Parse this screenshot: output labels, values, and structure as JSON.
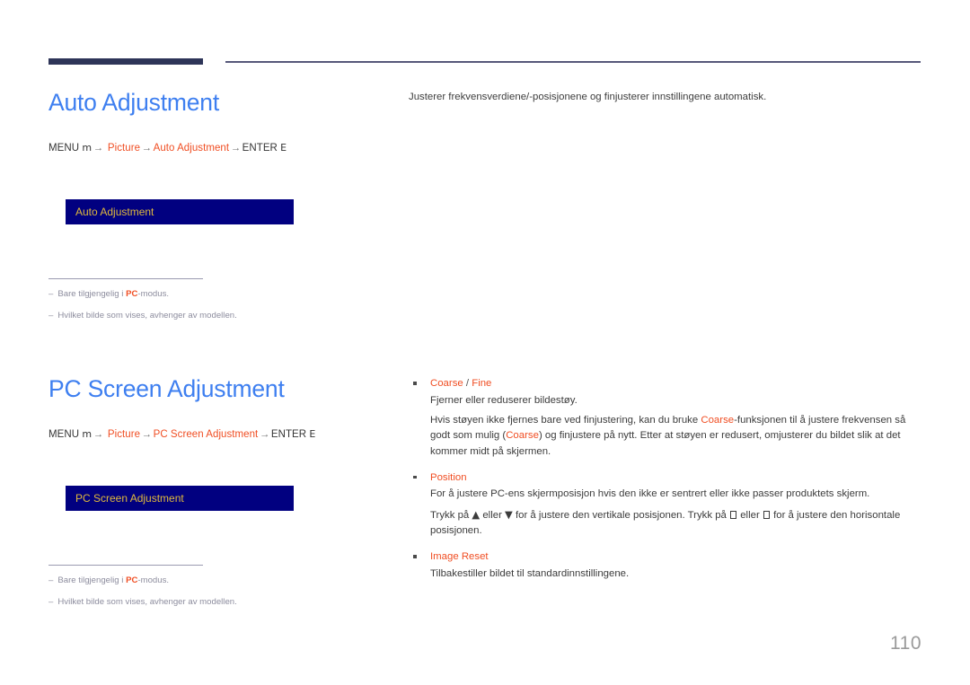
{
  "page": {
    "number": "110",
    "language": "no"
  },
  "header": {
    "rule_thick_color": "#2e3558",
    "rule_thin_color": "#56587a"
  },
  "colors": {
    "heading_blue": "#3e7ff0",
    "accent_orange": "#f04e23",
    "osd_background": "#010080",
    "osd_text": "#e0b93c",
    "note_gray": "#8d8d9e",
    "body_gray": "#3c3c3c"
  },
  "sections": [
    {
      "id": "auto-adjustment",
      "title": "Auto Adjustment",
      "menu_path": {
        "prefix": "MENU",
        "prefix_glyph": "m",
        "arrow": "→",
        "steps": [
          "Picture",
          "Auto Adjustment"
        ],
        "suffix": "ENTER",
        "suffix_glyph": "E"
      },
      "osd_label": "Auto Adjustment",
      "notes": [
        {
          "dash": "–",
          "pre": "Bare tilgjengelig i ",
          "hl": "PC",
          "post": "-modus."
        },
        {
          "dash": "–",
          "pre": "Hvilket bilde som vises, avhenger av modellen.",
          "hl": "",
          "post": ""
        }
      ],
      "intro": "Justerer frekvensverdiene/-posisjonene og finjusterer innstillingene automatisk."
    },
    {
      "id": "pc-screen-adjustment",
      "title": "PC Screen Adjustment",
      "menu_path": {
        "prefix": "MENU",
        "prefix_glyph": "m",
        "arrow": "→",
        "steps": [
          "Picture",
          "PC Screen Adjustment"
        ],
        "suffix": "ENTER",
        "suffix_glyph": "E"
      },
      "osd_label": "PC Screen Adjustment",
      "notes": [
        {
          "dash": "–",
          "pre": "Bare tilgjengelig i ",
          "hl": "PC",
          "post": "-modus."
        },
        {
          "dash": "–",
          "pre": "Hvilket bilde som vises, avhenger av modellen.",
          "hl": "",
          "post": ""
        }
      ],
      "features": [
        {
          "title_main": "Coarse",
          "title_sep": " / ",
          "title_alt": "Fine",
          "body_1": "Fjerner eller reduserer bildestøy.",
          "body_2_part1": "Hvis støyen ikke fjernes bare ved finjustering, kan du bruke ",
          "body_2_hl1": "Coarse",
          "body_2_part2": "-funksjonen til å justere frekvensen så godt som mulig (",
          "body_2_hl2": "Coarse",
          "body_2_part3": ") og finjustere på nytt. Etter at støyen er redusert, omjusterer du bildet slik at det kommer midt på skjermen."
        },
        {
          "title_main": "Position",
          "title_sep": "",
          "title_alt": "",
          "body_1": "For å justere PC-ens skjermposisjon hvis den ikke er sentrert eller ikke passer produktets skjerm.",
          "body_2_part1": "Trykk på ",
          "body_2_glyph_up": "▲",
          "body_2_part2": " eller ",
          "body_2_glyph_down": "▼",
          "body_2_part3": " for å justere den vertikale posisjonen. Trykk på ",
          "body_2_part4": " eller ",
          "body_2_part5": " for å justere den horisontale posisjonen."
        },
        {
          "title_main": "Image Reset",
          "title_sep": "",
          "title_alt": "",
          "body_1": "Tilbakestiller bildet til standardinnstillingene.",
          "body_2_part1": "",
          "body_2_part2": "",
          "body_2_part3": ""
        }
      ]
    }
  ]
}
